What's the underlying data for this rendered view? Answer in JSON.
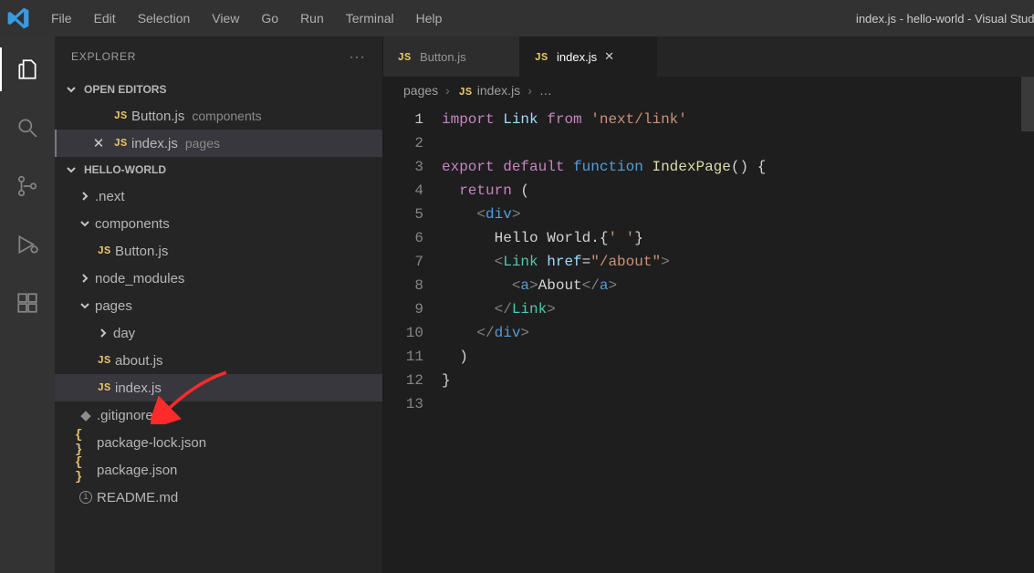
{
  "window_title": "index.js - hello-world - Visual Studio Code",
  "menu": [
    "File",
    "Edit",
    "Selection",
    "View",
    "Go",
    "Run",
    "Terminal",
    "Help"
  ],
  "sidebar": {
    "title": "EXPLORER",
    "open_editors": {
      "label": "OPEN EDITORS",
      "items": [
        {
          "icon": "js",
          "name": "Button.js",
          "meta": "components",
          "active": false,
          "close_x": false
        },
        {
          "icon": "js",
          "name": "index.js",
          "meta": "pages",
          "active": true,
          "close_x": true
        }
      ]
    },
    "workspace": {
      "label": "HELLO-WORLD",
      "tree": [
        {
          "kind": "folder",
          "name": ".next",
          "open": false,
          "indent": 1
        },
        {
          "kind": "folder",
          "name": "components",
          "open": true,
          "indent": 1
        },
        {
          "kind": "file",
          "name": "Button.js",
          "icon": "js",
          "indent": 2
        },
        {
          "kind": "folder",
          "name": "node_modules",
          "open": false,
          "indent": 1
        },
        {
          "kind": "folder",
          "name": "pages",
          "open": true,
          "indent": 1
        },
        {
          "kind": "folder",
          "name": "day",
          "open": false,
          "indent": 2
        },
        {
          "kind": "file",
          "name": "about.js",
          "icon": "js",
          "indent": 2
        },
        {
          "kind": "file",
          "name": "index.js",
          "icon": "js",
          "indent": 2,
          "selected": true
        },
        {
          "kind": "file",
          "name": ".gitignore",
          "icon": "git",
          "indent": 1
        },
        {
          "kind": "file",
          "name": "package-lock.json",
          "icon": "braces",
          "indent": 1
        },
        {
          "kind": "file",
          "name": "package.json",
          "icon": "braces",
          "indent": 1
        },
        {
          "kind": "file",
          "name": "README.md",
          "icon": "info",
          "indent": 1
        }
      ]
    }
  },
  "tabs": [
    {
      "icon": "js",
      "name": "Button.js",
      "active": false
    },
    {
      "icon": "js",
      "name": "index.js",
      "active": true
    }
  ],
  "breadcrumbs": [
    "pages",
    "index.js",
    "…"
  ],
  "code": {
    "lines": [
      {
        "n": 1,
        "tokens": [
          [
            "kw",
            "import"
          ],
          [
            "txt",
            " "
          ],
          [
            "var",
            "Link"
          ],
          [
            "txt",
            " "
          ],
          [
            "kw",
            "from"
          ],
          [
            "txt",
            " "
          ],
          [
            "str",
            "'next/link'"
          ]
        ]
      },
      {
        "n": 2,
        "tokens": []
      },
      {
        "n": 3,
        "tokens": [
          [
            "kw",
            "export"
          ],
          [
            "txt",
            " "
          ],
          [
            "kw",
            "default"
          ],
          [
            "txt",
            " "
          ],
          [
            "kw2",
            "function"
          ],
          [
            "txt",
            " "
          ],
          [
            "fn",
            "IndexPage"
          ],
          [
            "txt",
            "() "
          ],
          [
            "brk",
            "{"
          ]
        ]
      },
      {
        "n": 4,
        "tokens": [
          [
            "txt",
            "  "
          ],
          [
            "kw",
            "return"
          ],
          [
            "txt",
            " ("
          ]
        ]
      },
      {
        "n": 5,
        "tokens": [
          [
            "txt",
            "    "
          ],
          [
            "jsx",
            "<"
          ],
          [
            "kw2",
            "div"
          ],
          [
            "jsx",
            ">"
          ]
        ]
      },
      {
        "n": 6,
        "tokens": [
          [
            "txt",
            "      Hello World."
          ],
          [
            "brk",
            "{"
          ],
          [
            "str",
            "' '"
          ],
          [
            "brk",
            "}"
          ]
        ]
      },
      {
        "n": 7,
        "tokens": [
          [
            "txt",
            "      "
          ],
          [
            "jsx",
            "<"
          ],
          [
            "com",
            "Link"
          ],
          [
            "txt",
            " "
          ],
          [
            "var",
            "href"
          ],
          [
            "txt",
            "="
          ],
          [
            "str",
            "\"/about\""
          ],
          [
            "jsx",
            ">"
          ]
        ]
      },
      {
        "n": 8,
        "tokens": [
          [
            "txt",
            "        "
          ],
          [
            "jsx",
            "<"
          ],
          [
            "kw2",
            "a"
          ],
          [
            "jsx",
            ">"
          ],
          [
            "txt",
            "About"
          ],
          [
            "jsx",
            "</"
          ],
          [
            "kw2",
            "a"
          ],
          [
            "jsx",
            ">"
          ]
        ]
      },
      {
        "n": 9,
        "tokens": [
          [
            "txt",
            "      "
          ],
          [
            "jsx",
            "</"
          ],
          [
            "com",
            "Link"
          ],
          [
            "jsx",
            ">"
          ]
        ]
      },
      {
        "n": 10,
        "tokens": [
          [
            "txt",
            "    "
          ],
          [
            "jsx",
            "</"
          ],
          [
            "kw2",
            "div"
          ],
          [
            "jsx",
            ">"
          ]
        ]
      },
      {
        "n": 11,
        "tokens": [
          [
            "txt",
            "  )"
          ]
        ]
      },
      {
        "n": 12,
        "tokens": [
          [
            "brk",
            "}"
          ]
        ]
      },
      {
        "n": 13,
        "tokens": []
      }
    ],
    "current_line": 1
  }
}
